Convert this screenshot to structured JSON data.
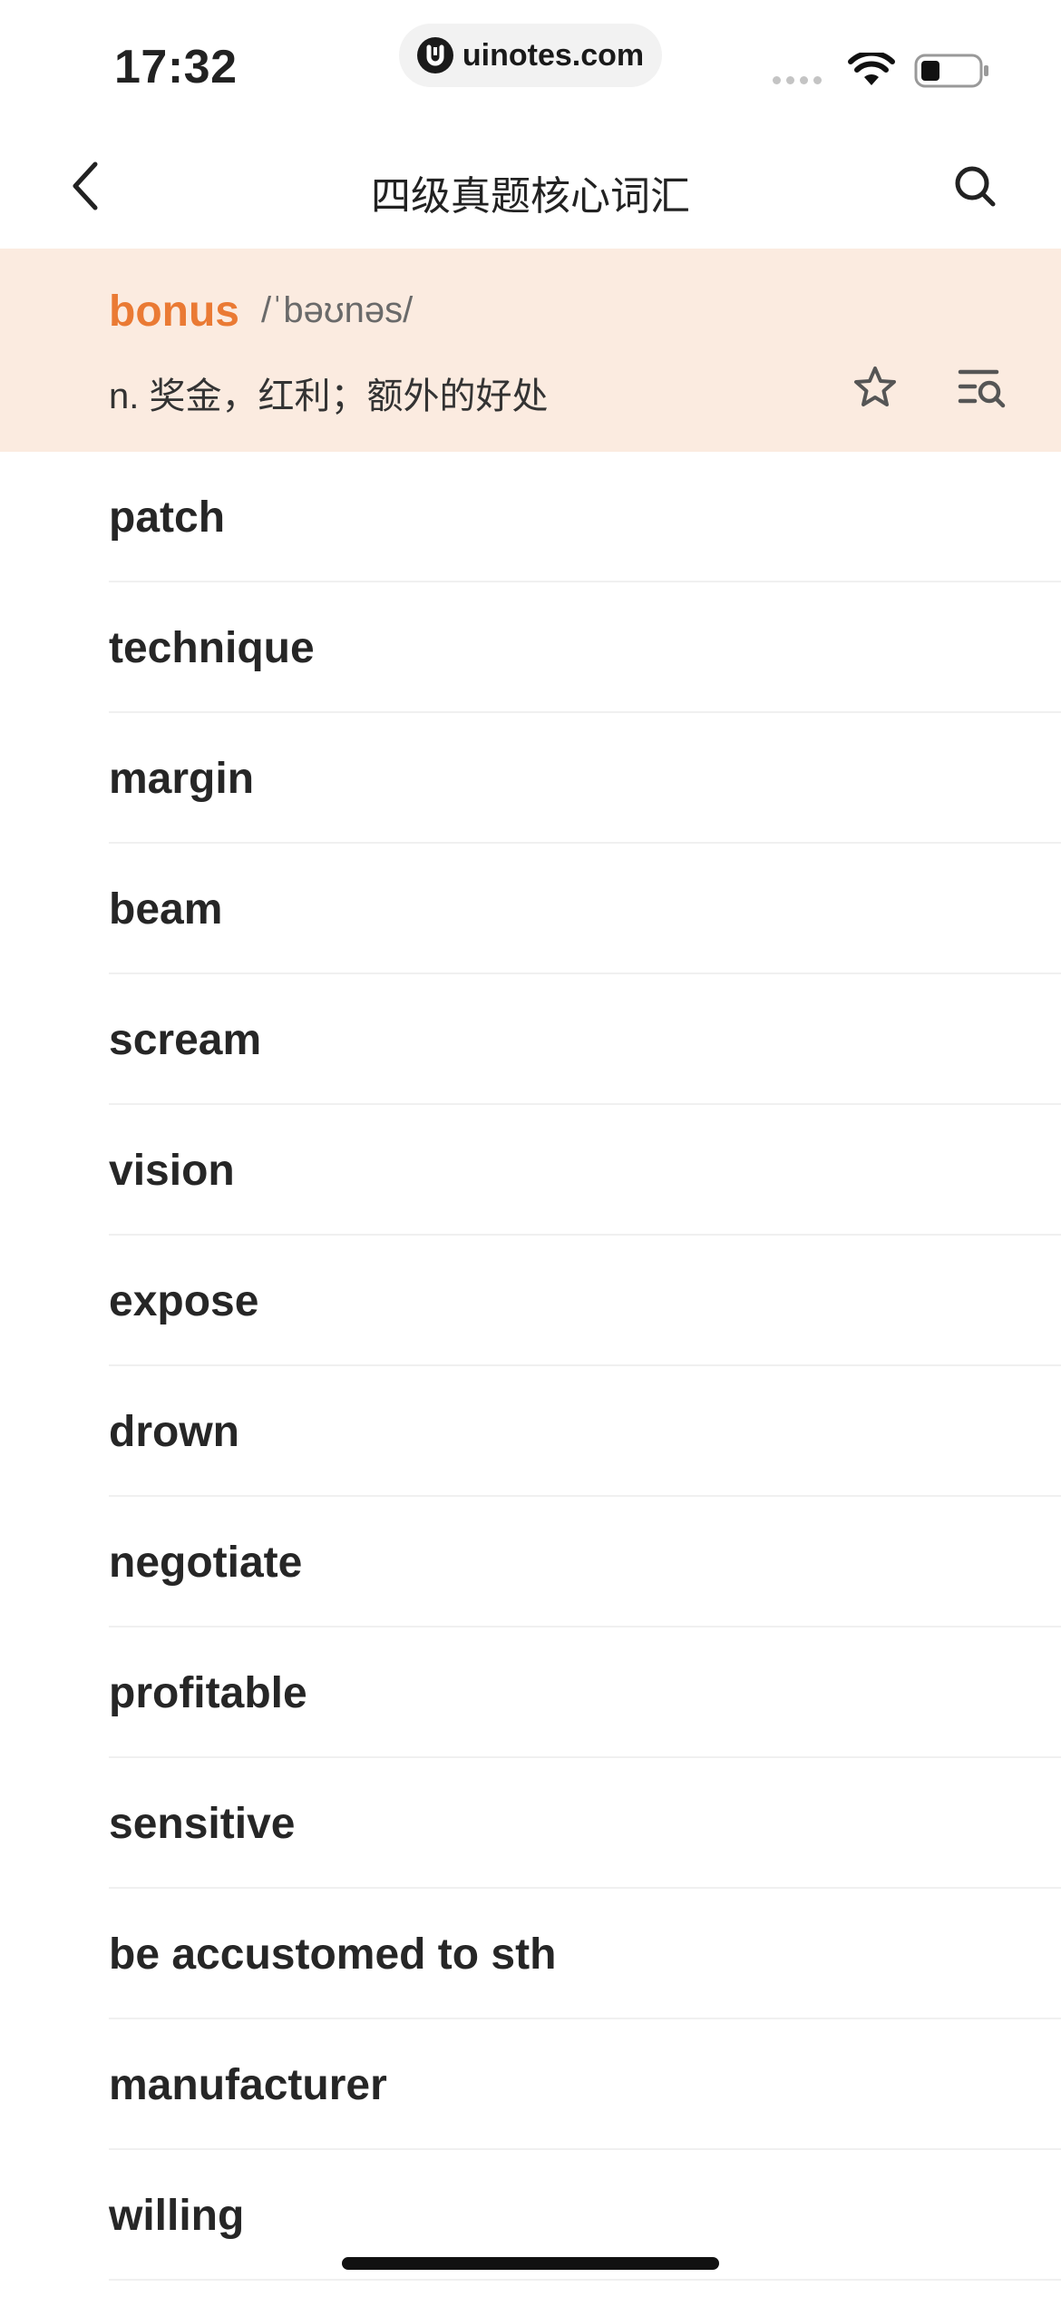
{
  "status_bar": {
    "time": "17:32",
    "url": "uinotes.com",
    "icons": [
      "signal-icon",
      "wifi-icon",
      "battery-icon"
    ]
  },
  "nav": {
    "title": "四级真题核心词汇",
    "back_icon": "chevron-left-icon",
    "search_icon": "search-icon"
  },
  "current_word": {
    "word": "bonus",
    "phonetic": "/ˈbəʊnəs/",
    "definition": "n. 奖金，红利；额外的好处",
    "star_icon": "star-outline-icon",
    "list_icon": "list-search-icon"
  },
  "words": [
    "patch",
    "technique",
    "margin",
    "beam",
    "scream",
    "vision",
    "expose",
    "drown",
    "negotiate",
    "profitable",
    "sensitive",
    "be accustomed to sth",
    "manufacturer",
    "willing"
  ],
  "colors": {
    "accent": "#ea7a34",
    "highlight_bg": "#fbebe0",
    "text": "#262626",
    "divider": "#f0f0f0"
  }
}
